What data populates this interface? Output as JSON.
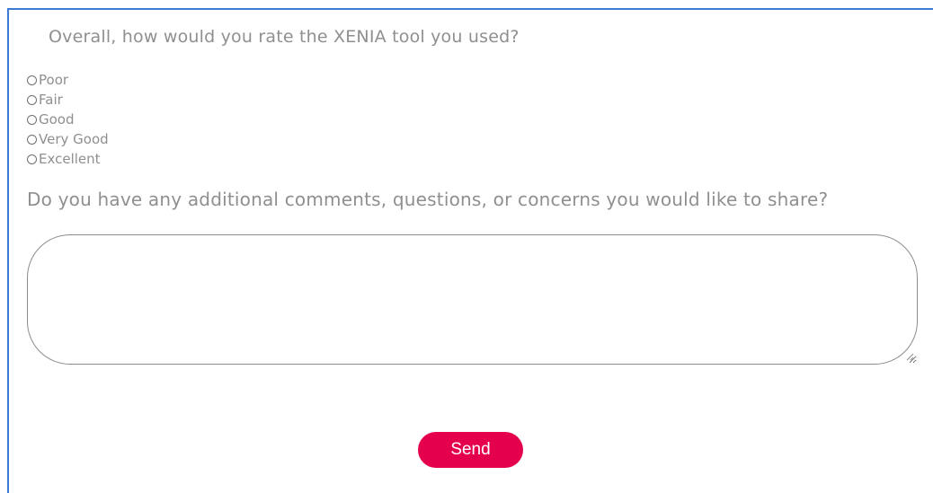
{
  "survey": {
    "rating_question": "Overall, how would you rate the XENIA tool you used?",
    "rating_options": [
      "Poor",
      "Fair",
      "Good",
      "Very Good",
      "Excellent"
    ],
    "comments_question": "Do you have any additional comments, questions, or concerns you would like to share?",
    "comments_value": "",
    "send_label": "Send"
  },
  "colors": {
    "accent": "#e5004d",
    "frame_border": "#3b7bd6",
    "text": "#8f8f8f"
  }
}
